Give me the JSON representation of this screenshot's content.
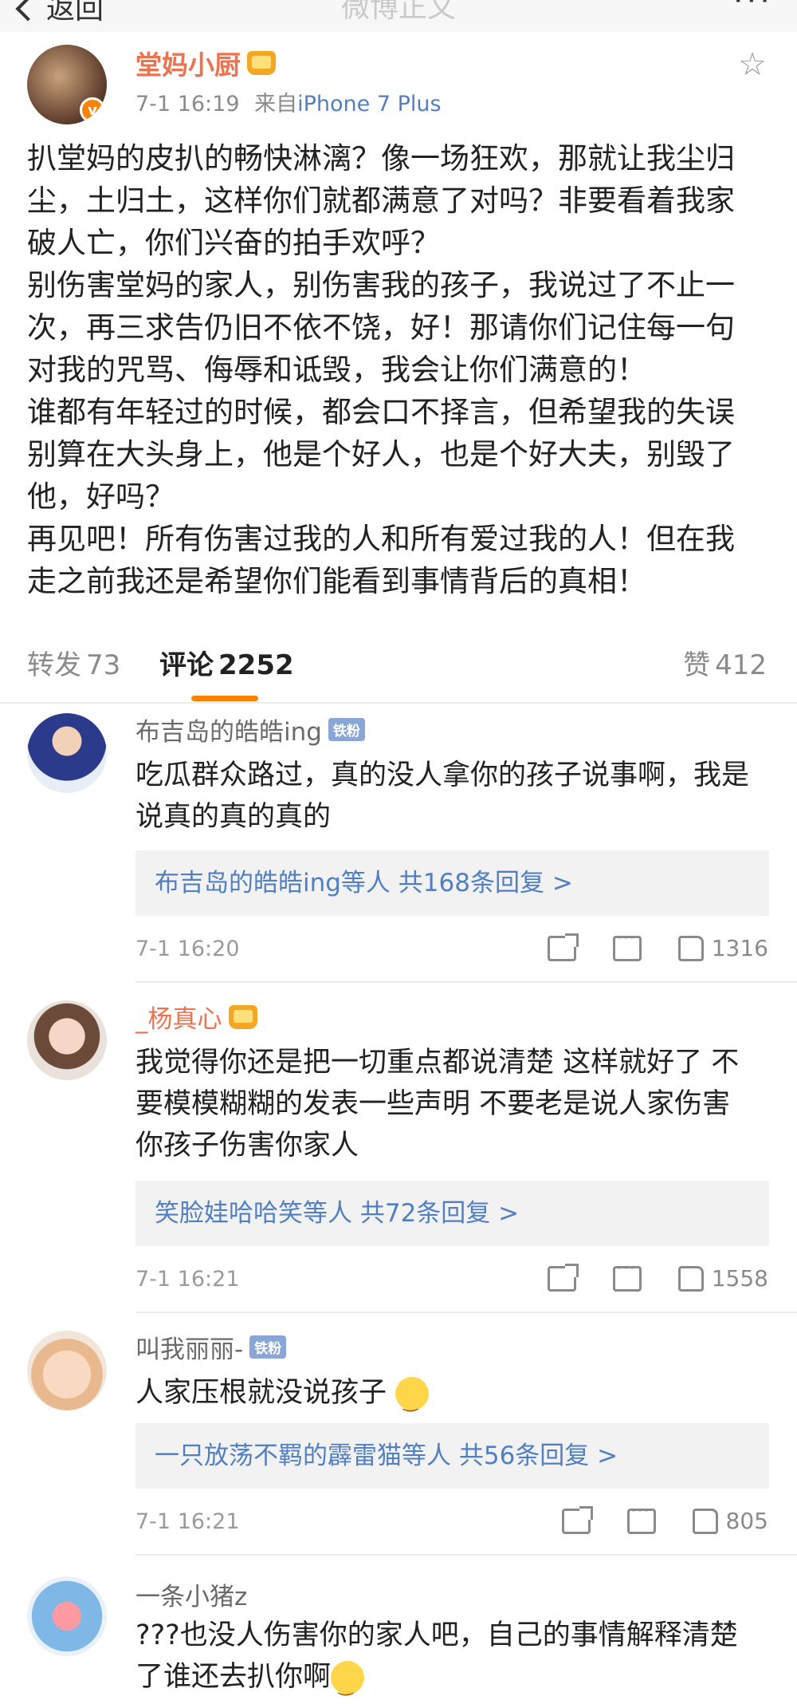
{
  "topbar": {
    "back_label": "返回",
    "title": "微博正文",
    "more_label": "···"
  },
  "post": {
    "author": "堂妈小厨",
    "time": "7-1 16:19",
    "source_prefix": "来自",
    "source": "iPhone 7 Plus",
    "lines": [
      "扒堂妈的皮扒的畅快淋漓？像一场狂欢，那就让我尘归",
      "尘，土归土，这样你们就都满意了对吗？非要看着我家",
      "破人亡，你们兴奋的拍手欢呼？",
      "别伤害堂妈的家人，别伤害我的孩子，我说过了不止一",
      "次，再三求告仍旧不依不饶，好！那请你们记住每一句",
      "对我的咒骂、侮辱和诋毁，我会让你们满意的！",
      "谁都有年轻过的时候，都会口不择言，但希望我的失误",
      "别算在大头身上，他是个好人，也是个好大夫，别毁了",
      "他，好吗？",
      "再见吧！所有伤害过我的人和所有爱过我的人！但在我",
      "走之前我还是希望你们能看到事情背后的真相！"
    ]
  },
  "tabs": {
    "repost_label": "转发",
    "repost_count": "73",
    "comment_label": "评论",
    "comment_count": "2252",
    "like_label": "赞",
    "like_count": "412"
  },
  "comments": [
    {
      "user": "布吉岛的皓皓ing",
      "badge": "铁粉",
      "lines": [
        "吃瓜群众路过，真的没人拿你的孩子说事啊，我是",
        "说真的真的真的"
      ],
      "reply_summary": "布吉岛的皓皓ing等人  共168条回复 >",
      "time": "7-1 16:20",
      "likes": "1316"
    },
    {
      "user": "_杨真心",
      "lines": [
        "我觉得你还是把一切重点都说清楚 这样就好了 不",
        "要模模糊糊的发表一些声明 不要老是说人家伤害",
        "你孩子伤害你家人"
      ],
      "reply_summary": "笑脸娃哈哈笑等人  共72条回复 >",
      "time": "7-1 16:21",
      "likes": "1558"
    },
    {
      "user": "叫我丽丽-",
      "badge": "铁粉",
      "lines": [
        "人家压根就没说孩子"
      ],
      "reply_summary": "一只放荡不羁的霹雷猫等人  共56条回复 >",
      "time": "7-1 16:21",
      "likes": "805"
    },
    {
      "user": "一条小猪z",
      "lines": [
        "???也没人伤害你的家人吧，自己的事情解释清楚",
        "了谁还去扒你啊"
      ]
    }
  ]
}
